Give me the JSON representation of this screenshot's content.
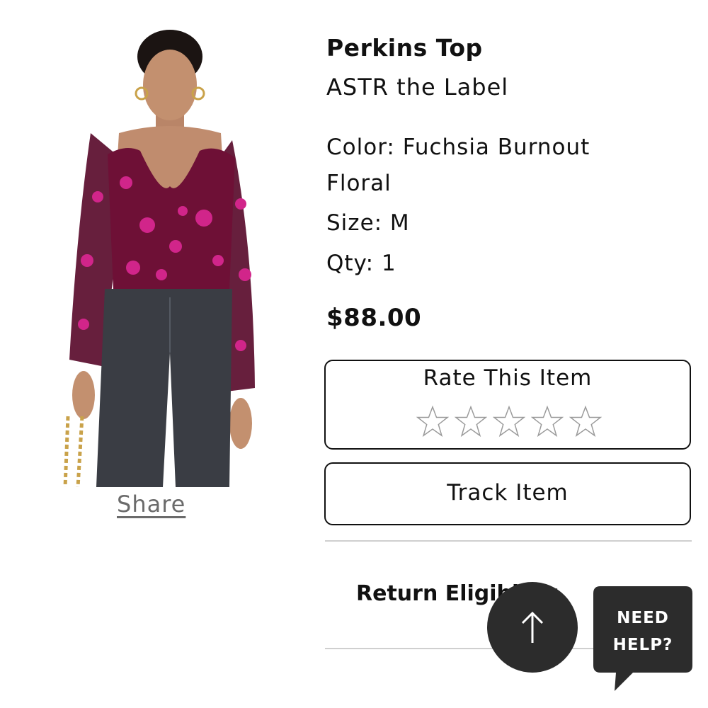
{
  "product": {
    "name": "Perkins Top",
    "brand": "ASTR the Label",
    "color_line": "Color: Fuchsia Burnout Floral",
    "size_line": "Size: M",
    "qty_line": "Qty: 1",
    "price": "$88.00"
  },
  "actions": {
    "share": "Share",
    "rate_title": "Rate This Item",
    "rating": {
      "value": 0,
      "max": 5
    },
    "track": "Track Item",
    "return": "Return Eligibility"
  },
  "help": {
    "line1": "NEED",
    "line2": "HELP?"
  },
  "colors": {
    "accent_dark": "#2c2c2c",
    "top_fabric": "#6e1036",
    "floral": "#d1258a",
    "denim": "#3a3d44"
  }
}
